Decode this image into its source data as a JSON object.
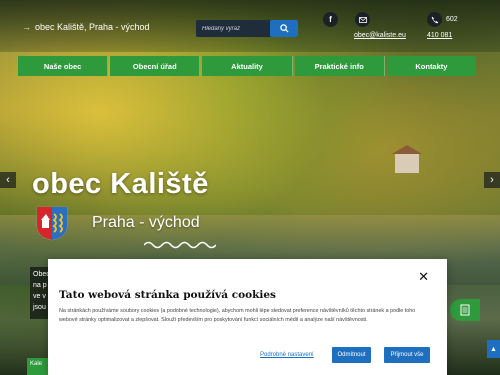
{
  "header": {
    "site_link": "obec Kaliště, Praha - východ",
    "search_placeholder": "Hledaný výraz",
    "email": "obec@kaliste.eu",
    "phone_line1": "602",
    "phone_line2": "410 081"
  },
  "nav": {
    "items": [
      {
        "label": "Naše obec"
      },
      {
        "label": "Obecní úřad"
      },
      {
        "label": "Aktuality"
      },
      {
        "label": "Praktické info"
      },
      {
        "label": "Kontakty"
      }
    ]
  },
  "hero": {
    "title": "obec Kaliště",
    "subtitle": "Praha - východ"
  },
  "info_box": {
    "line1": "Obec",
    "line2": "na p",
    "line3": "ve v",
    "line4": "jsou"
  },
  "bottom_tab": {
    "label": "Kale"
  },
  "cookie": {
    "title": "Tato webová stránka používá cookies",
    "text": "Na stránkách používáme soubory cookies (a podobné technologie), abychom mohli lépe sledovat preference návštěvníků těchto stránek a podle toho webové stránky optimalizovat a zlepšovat. Slouží především pro poskytování funkcí sociálních médií a analýze naší návštěvnosti.",
    "settings_link": "Podrobné nastavení",
    "reject_label": "Odmítnout",
    "accept_label": "Přijmout vše"
  },
  "colors": {
    "nav_green": "#2e9a3c",
    "accent_blue": "#1f6fc0"
  }
}
